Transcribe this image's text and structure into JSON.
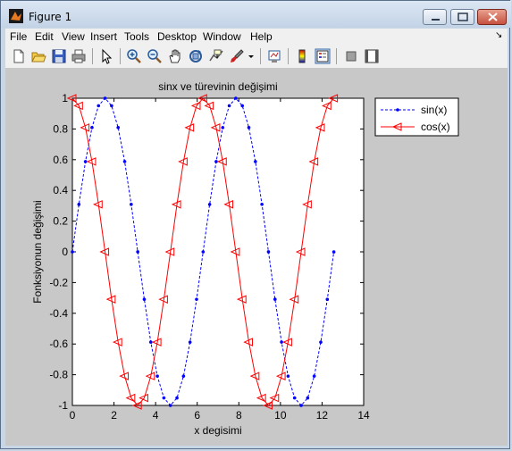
{
  "window": {
    "title": "Figure 1"
  },
  "menu": [
    "File",
    "Edit",
    "View",
    "Insert",
    "Tools",
    "Desktop",
    "Window",
    "Help"
  ],
  "toolbar": {
    "icons": [
      "new-figure-icon",
      "open-file-icon",
      "save-icon",
      "print-icon",
      "select-pointer-icon",
      "zoom-in-icon",
      "zoom-out-icon",
      "pan-hand-icon",
      "rotate-3d-icon",
      "data-cursor-icon",
      "brush-icon",
      "dropdown-arrow-icon",
      "link-plot-icon",
      "colorbar-icon",
      "legend-icon",
      "hide-plot-tools-icon",
      "show-plot-tools-icon"
    ]
  },
  "chart_data": {
    "type": "line",
    "title": "sinx ve türevinin değişimi",
    "xlabel": "x degisimi",
    "ylabel": "Fonksiyonun değişimi",
    "xlim": [
      0,
      14
    ],
    "ylim": [
      -1,
      1
    ],
    "xticks": [
      0,
      2,
      4,
      6,
      8,
      10,
      12,
      14
    ],
    "yticks": [
      -1,
      -0.8,
      -0.6,
      -0.4,
      -0.2,
      0,
      0.2,
      0.4,
      0.6,
      0.8,
      1
    ],
    "grid": false,
    "legend_position": "top-right",
    "series": [
      {
        "name": "sin(x)",
        "function": "sin",
        "x_start": 0,
        "x_end": 12.566,
        "n_points": 41,
        "color": "#0000ff",
        "line_style": "dashed",
        "marker": "dot"
      },
      {
        "name": "cos(x)",
        "function": "cos",
        "x_start": 0,
        "x_end": 12.566,
        "n_points": 41,
        "color": "#ff0000",
        "line_style": "solid",
        "marker": "triangle-left"
      }
    ]
  }
}
